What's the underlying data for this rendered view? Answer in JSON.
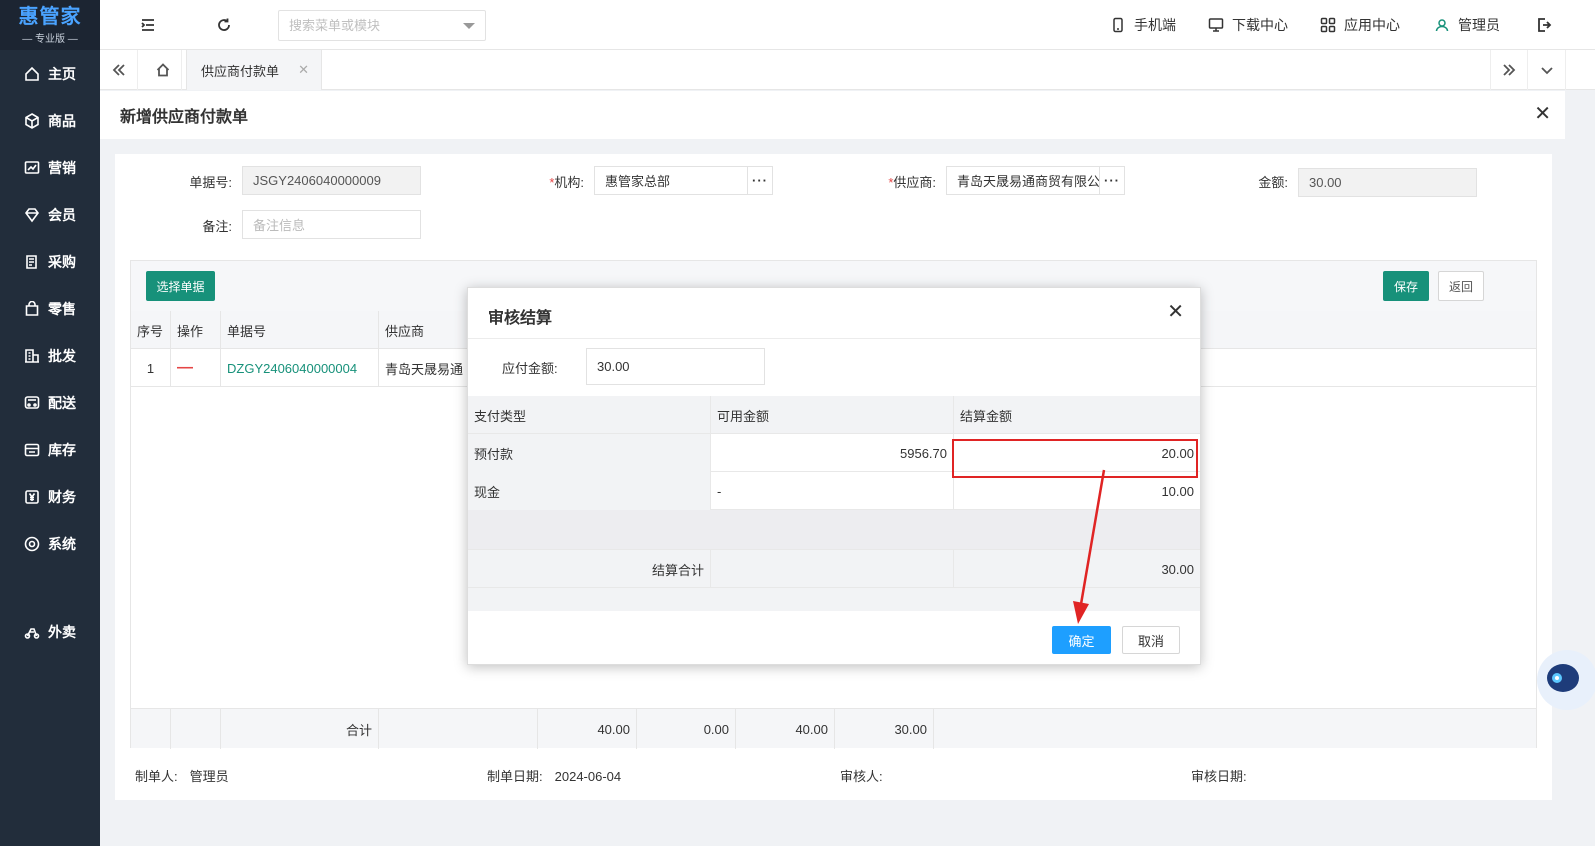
{
  "brand": {
    "name": "惠管家",
    "edition": "专业版"
  },
  "sidebar": {
    "items": [
      {
        "label": "主页",
        "icon": "home-icon"
      },
      {
        "label": "商品",
        "icon": "box-icon"
      },
      {
        "label": "营销",
        "icon": "chart-icon"
      },
      {
        "label": "会员",
        "icon": "diamond-icon"
      },
      {
        "label": "采购",
        "icon": "purchase-icon"
      },
      {
        "label": "零售",
        "icon": "bag-icon"
      },
      {
        "label": "批发",
        "icon": "building-icon"
      },
      {
        "label": "配送",
        "icon": "truck-icon"
      },
      {
        "label": "库存",
        "icon": "store-icon"
      },
      {
        "label": "财务",
        "icon": "yen-icon"
      },
      {
        "label": "系统",
        "icon": "settings-icon"
      },
      {
        "label": "外卖",
        "icon": "scooter-icon"
      }
    ]
  },
  "header": {
    "search_placeholder": "搜索菜单或模块",
    "links": {
      "mobile": "手机端",
      "download": "下载中心",
      "apps": "应用中心",
      "user": "管理员"
    }
  },
  "tabs": {
    "active": "供应商付款单"
  },
  "page": {
    "title": "新增供应商付款单"
  },
  "form": {
    "doc_no_label": "单据号:",
    "doc_no": "JSGY2406040000009",
    "org_label": "*机构:",
    "org": "惠管家总部",
    "supplier_label": "*供应商:",
    "supplier": "青岛天晟易通商贸有限公司",
    "amount_label": "金额:",
    "amount": "30.00",
    "remark_label": "备注:",
    "remark_placeholder": "备注信息"
  },
  "grid": {
    "select_btn": "选择单据",
    "save_btn": "保存",
    "back_btn": "返回",
    "headers": [
      "序号",
      "操作",
      "单据号",
      "供应商"
    ],
    "rows": [
      {
        "index": "1",
        "doc_no": "DZGY2406040000004",
        "supplier": "青岛天晟易通"
      }
    ],
    "footer": {
      "label": "合计",
      "totals": [
        "40.00",
        "0.00",
        "40.00",
        "30.00"
      ]
    }
  },
  "meta": {
    "creator_label": "制单人:",
    "creator": "管理员",
    "created_label": "制单日期:",
    "created": "2024-06-04",
    "auditor_label": "审核人:",
    "audit_date_label": "审核日期:"
  },
  "modal": {
    "title": "审核结算",
    "payable_label": "应付金额:",
    "payable": "30.00",
    "headers": [
      "支付类型",
      "可用金额",
      "结算金额"
    ],
    "rows": [
      {
        "type": "预付款",
        "available": "5956.70",
        "settle": "20.00"
      },
      {
        "type": "现金",
        "available": "-",
        "settle": "10.00"
      }
    ],
    "total_label": "结算合计",
    "total": "30.00",
    "confirm_btn": "确定",
    "cancel_btn": "取消"
  },
  "colors": {
    "accent": "#17917a",
    "primary": "#1e9fff",
    "sidebar": "#222d3b",
    "highlight": "#e02424"
  }
}
